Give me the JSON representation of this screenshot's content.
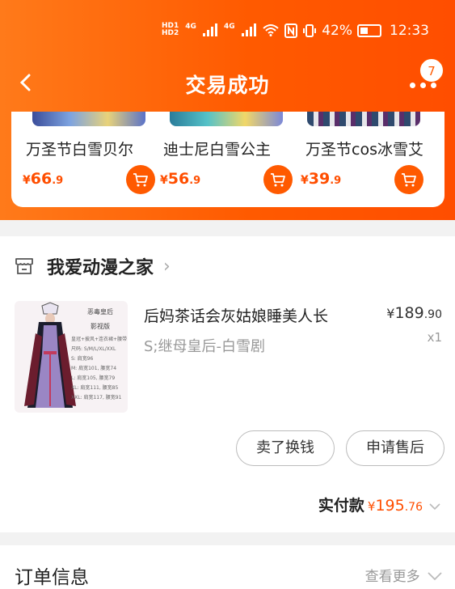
{
  "colors": {
    "accent": "#ff5a00",
    "price": "#ff4e00"
  },
  "status_bar": {
    "hd1": "HD",
    "hd1_sub": "1",
    "hd2": "HD",
    "hd2_sub": "2",
    "net1": "4G",
    "net2": "4G",
    "battery_text": "42%",
    "battery_level": 0.42,
    "time": "12:33"
  },
  "nav": {
    "back_icon": "chevron-left-icon",
    "title": "交易成功",
    "more_icon": "more-dots-icon",
    "badge_count": "7"
  },
  "recommend": {
    "items": [
      {
        "name": "万圣节白雪贝尔",
        "currency": "¥",
        "price_int": "66",
        "price_dec": ".9"
      },
      {
        "name": "迪士尼白雪公主",
        "currency": "¥",
        "price_int": "56",
        "price_dec": ".9"
      },
      {
        "name": "万圣节cos冰雪艾",
        "currency": "¥",
        "price_int": "39",
        "price_dec": ".9"
      }
    ]
  },
  "shop": {
    "icon": "store-icon",
    "name": "我爱动漫之家",
    "arrow": "›"
  },
  "product": {
    "image_text": {
      "title": "恶毒皇后",
      "subtitle": "影视版",
      "line1": "皇冠+披风+连衣裙+腰带",
      "line2": "尺码: S/M/L/XL/XXL",
      "line3": "S: 肩宽96",
      "line4": "M: 肩宽101, 腰宽74",
      "line5": "L: 肩宽105, 腰宽79",
      "line6": "XL: 肩宽111, 腰宽85",
      "line7": "XXL: 肩宽117, 腰宽91"
    },
    "title": "后妈茶话会灰姑娘睡美人长",
    "sku": "S;继母皇后-白雪剧",
    "currency": "¥",
    "price_int": "189",
    "price_dec": ".90",
    "quantity": "x1"
  },
  "actions": {
    "resell": "卖了换钱",
    "after_sale": "申请售后"
  },
  "payment": {
    "label": "实付款",
    "currency": "¥",
    "amount_int": "195",
    "amount_dec": ".76"
  },
  "order_info": {
    "title": "订单信息",
    "more": "查看更多"
  }
}
